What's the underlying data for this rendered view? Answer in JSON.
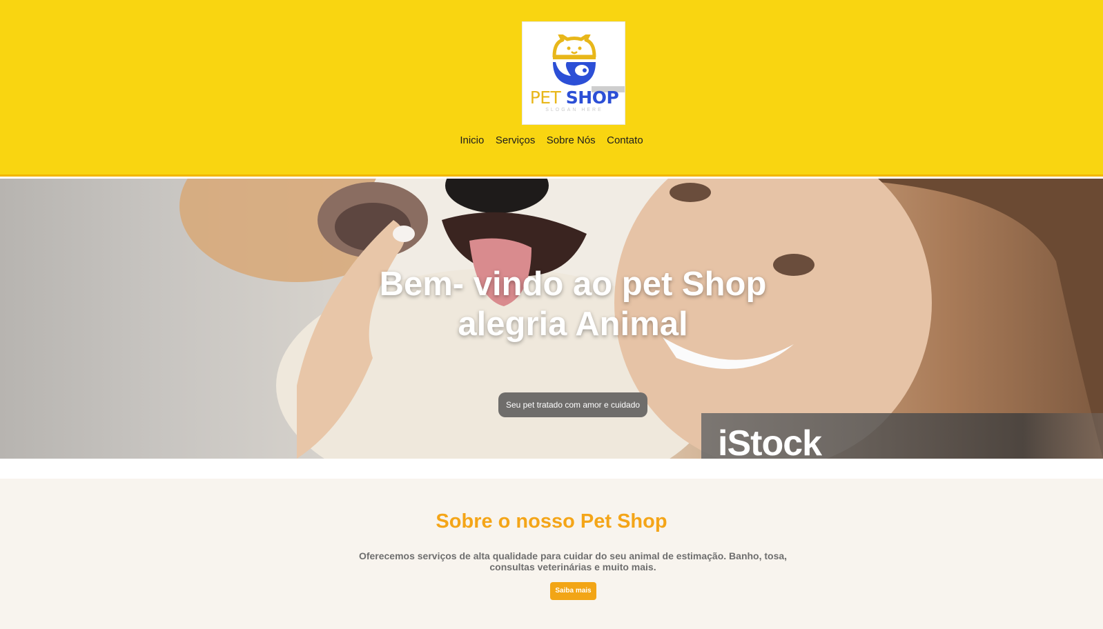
{
  "brand": {
    "logo_word_pet": "PET",
    "logo_word_shop": "SHOP",
    "logo_slogan": "SLOGAN HERE"
  },
  "nav": {
    "items": [
      {
        "label": "Inicio"
      },
      {
        "label": "Serviços"
      },
      {
        "label": "Sobre Nós"
      },
      {
        "label": "Contato"
      }
    ]
  },
  "hero": {
    "title": "Bem- vindo ao pet Shop alegria Animal",
    "badge": "Seu pet tratado com amor e cuidado",
    "watermark": "iStock"
  },
  "about": {
    "title": "Sobre o nosso Pet Shop",
    "text": "Oferecemos serviços de alta qualidade para cuidar do seu animal de estimação. Banho, tosa, consultas veterinárias e muito mais.",
    "button": "Saiba mais"
  },
  "colors": {
    "header_bg": "#f9d511",
    "accent": "#f4a518",
    "about_bg": "#f8f4ee",
    "logo_blue": "#2c4fd6",
    "logo_yellow": "#e8b71a"
  }
}
